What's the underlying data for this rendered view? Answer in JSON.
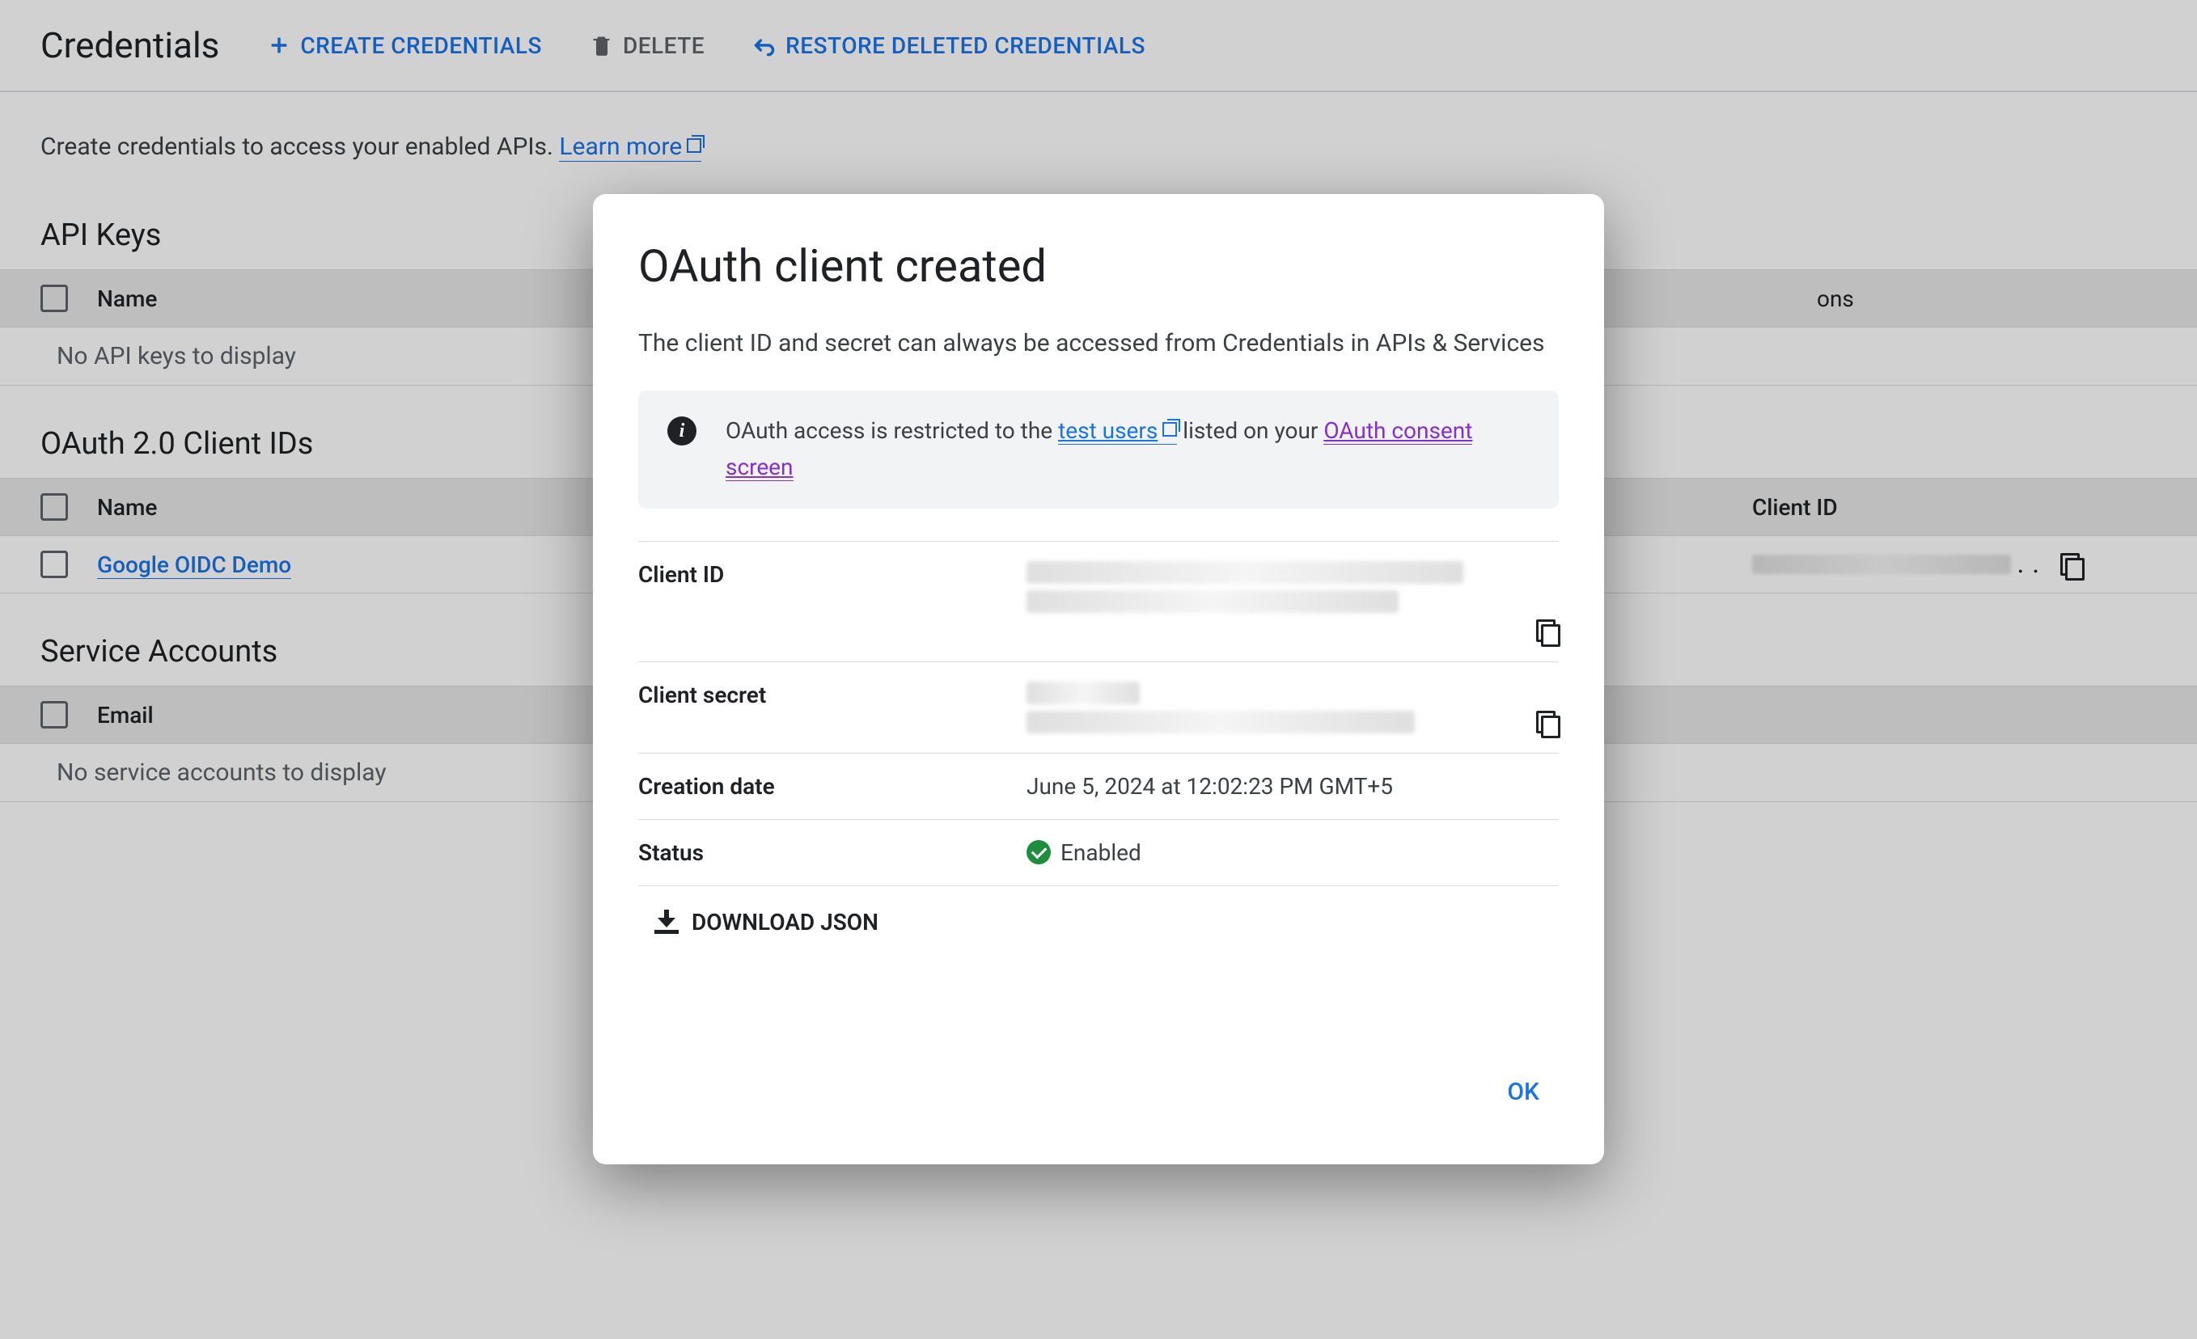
{
  "header": {
    "title": "Credentials",
    "create_label": "CREATE CREDENTIALS",
    "delete_label": "DELETE",
    "restore_label": "RESTORE DELETED CREDENTIALS"
  },
  "intro": {
    "text": "Create credentials to access your enabled APIs. ",
    "learn_more": "Learn more"
  },
  "sections": {
    "api_keys": {
      "title": "API Keys",
      "col_name": "Name",
      "col_right": "ons",
      "empty": "No API keys to display"
    },
    "oauth_clients": {
      "title": "OAuth 2.0 Client IDs",
      "col_name": "Name",
      "col_clientid": "Client ID",
      "rows": [
        {
          "name": "Google OIDC Demo",
          "client_id_redacted": true
        }
      ]
    },
    "service_accounts": {
      "title": "Service Accounts",
      "col_email": "Email",
      "empty": "No service accounts to display"
    }
  },
  "modal": {
    "title": "OAuth client created",
    "subtext": "The client ID and secret can always be accessed from Credentials in APIs & Services",
    "info_prefix": "OAuth access is restricted to the ",
    "info_link1": "test users",
    "info_middle": " listed on your ",
    "info_link2": "OAuth consent screen",
    "client_id_label": "Client ID",
    "client_secret_label": "Client secret",
    "creation_date_label": "Creation date",
    "creation_date_value": "June 5, 2024 at 12:02:23 PM GMT+5",
    "status_label": "Status",
    "status_value": "Enabled",
    "download_label": "DOWNLOAD JSON",
    "ok_label": "OK"
  },
  "redacted_dots": ". ."
}
